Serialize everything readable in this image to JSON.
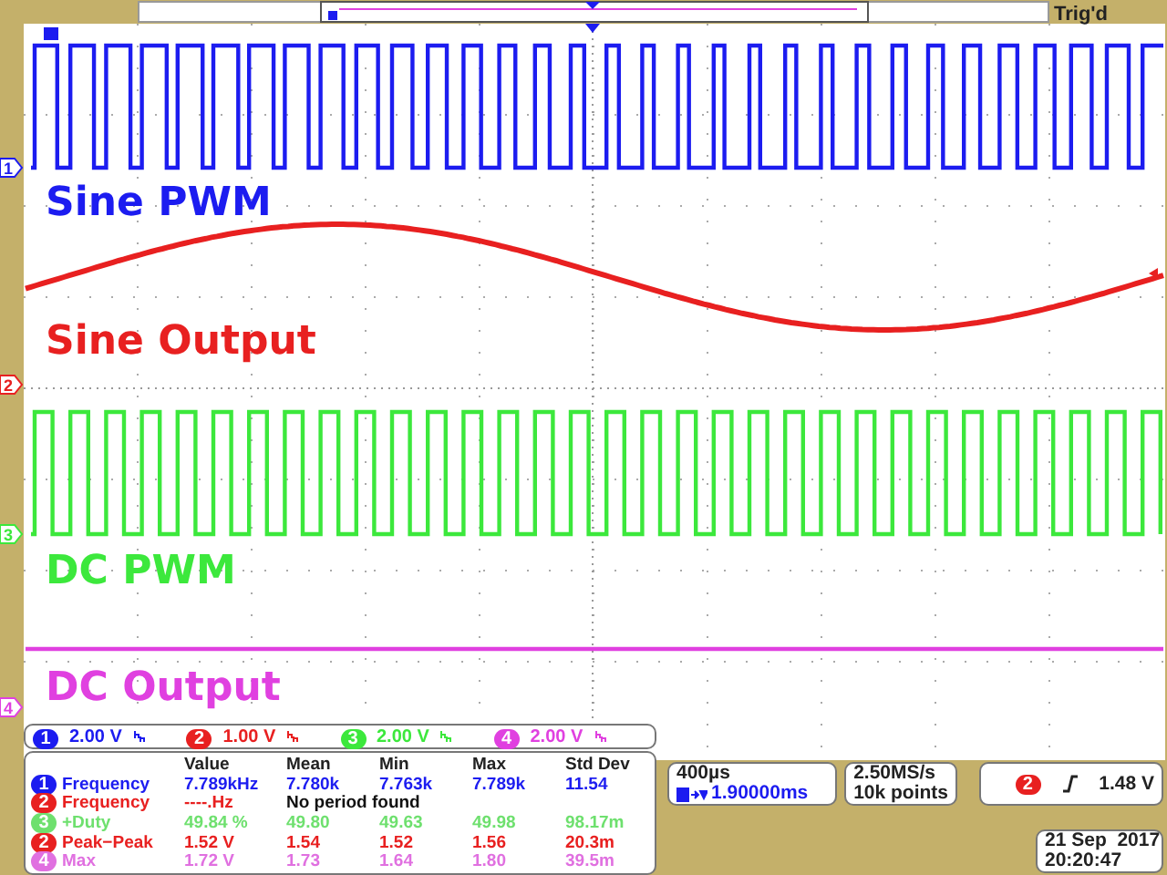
{
  "top_bar": {
    "status": "Trig'd"
  },
  "channels": [
    {
      "number": "1",
      "marker": "1",
      "color": "#1c1cf0",
      "kind": "sine_pwm",
      "label": "Sine PWM",
      "scale": "2.00 V"
    },
    {
      "number": "2",
      "marker": "2",
      "color": "#e82020",
      "kind": "sine",
      "label": "Sine Output",
      "scale": "1.00 V"
    },
    {
      "number": "3",
      "marker": "3",
      "color": "#3ce83c",
      "kind": "pwm",
      "label": "DC PWM",
      "scale": "2.00 V"
    },
    {
      "number": "4",
      "marker": "4",
      "color": "#e040e0",
      "kind": "dc",
      "label": "DC Output",
      "scale": "2.00 V"
    }
  ],
  "measurements": {
    "columns": [
      "Value",
      "Mean",
      "Min",
      "Max",
      "Std Dev"
    ],
    "rows": [
      {
        "channel": "1",
        "color": "#1c1cf0",
        "name": "Frequency",
        "cells": [
          "7.789kHz",
          "7.780k",
          "7.763k",
          "7.789k",
          "11.54"
        ]
      },
      {
        "channel": "2",
        "color": "#e82020",
        "name": "Frequency",
        "cells": [
          "----.Hz"
        ],
        "note": "No period found"
      },
      {
        "channel": "3",
        "color": "#6ee06e",
        "name": "+Duty",
        "cells": [
          "49.84 %",
          "49.80",
          "49.63",
          "49.98",
          "98.17m"
        ]
      },
      {
        "channel": "2",
        "color": "#e82020",
        "name": "Peak−Peak",
        "cells": [
          "1.52 V",
          "1.54",
          "1.52",
          "1.56",
          "20.3m"
        ]
      },
      {
        "channel": "4",
        "color": "#e070e0",
        "name": "Max",
        "cells": [
          "1.72 V",
          "1.73",
          "1.64",
          "1.80",
          "39.5m"
        ]
      }
    ]
  },
  "timebase": {
    "scale": "400µs",
    "position": "1.90000ms"
  },
  "acquisition": {
    "rate": "2.50MS/s",
    "length": "10k points"
  },
  "trigger": {
    "channel": "2",
    "color": "#e82020",
    "threshold": "1.48 V"
  },
  "datetime": {
    "date": "21 Sep  2017",
    "time": "20:20:47"
  }
}
